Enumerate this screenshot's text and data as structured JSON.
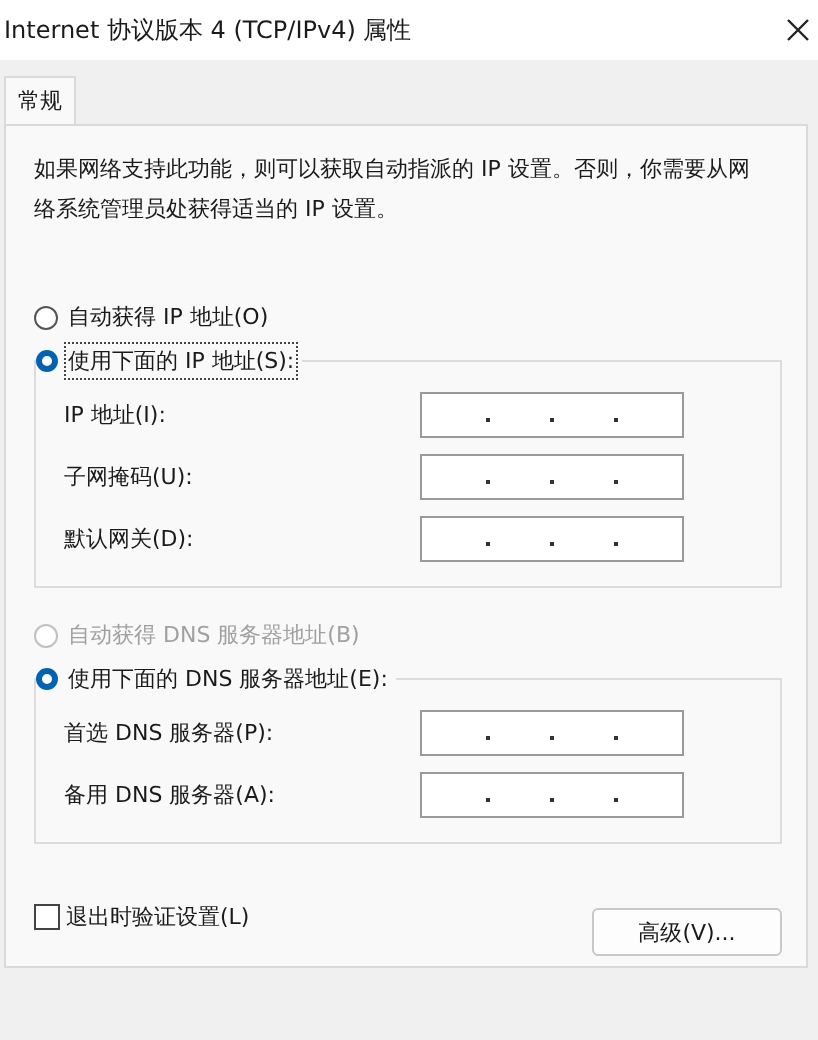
{
  "window": {
    "title": "Internet 协议版本 4 (TCP/IPv4) 属性"
  },
  "tabs": [
    {
      "label": "常规",
      "selected": true
    }
  ],
  "description": "如果网络支持此功能，则可以获取自动指派的 IP 设置。否则，你需要从网络系统管理员处获得适当的 IP 设置。",
  "ip_options": [
    {
      "label": "自动获得 IP 地址(O)",
      "selected": false,
      "disabled": false,
      "focused": false
    },
    {
      "label": "使用下面的 IP 地址(S):",
      "selected": true,
      "disabled": false,
      "focused": true
    }
  ],
  "ip_fields": [
    {
      "label": "IP 地址(I):"
    },
    {
      "label": "子网掩码(U):"
    },
    {
      "label": "默认网关(D):"
    }
  ],
  "dns_options": [
    {
      "label": "自动获得 DNS 服务器地址(B)",
      "selected": false,
      "disabled": true,
      "focused": false
    },
    {
      "label": "使用下面的 DNS 服务器地址(E):",
      "selected": true,
      "disabled": false,
      "focused": false
    }
  ],
  "dns_fields": [
    {
      "label": "首选 DNS 服务器(P):"
    },
    {
      "label": "备用 DNS 服务器(A):"
    }
  ],
  "validate_checkbox": {
    "label": "退出时验证设置(L)",
    "checked": false
  },
  "advanced_button": {
    "label": "高级(V)..."
  }
}
